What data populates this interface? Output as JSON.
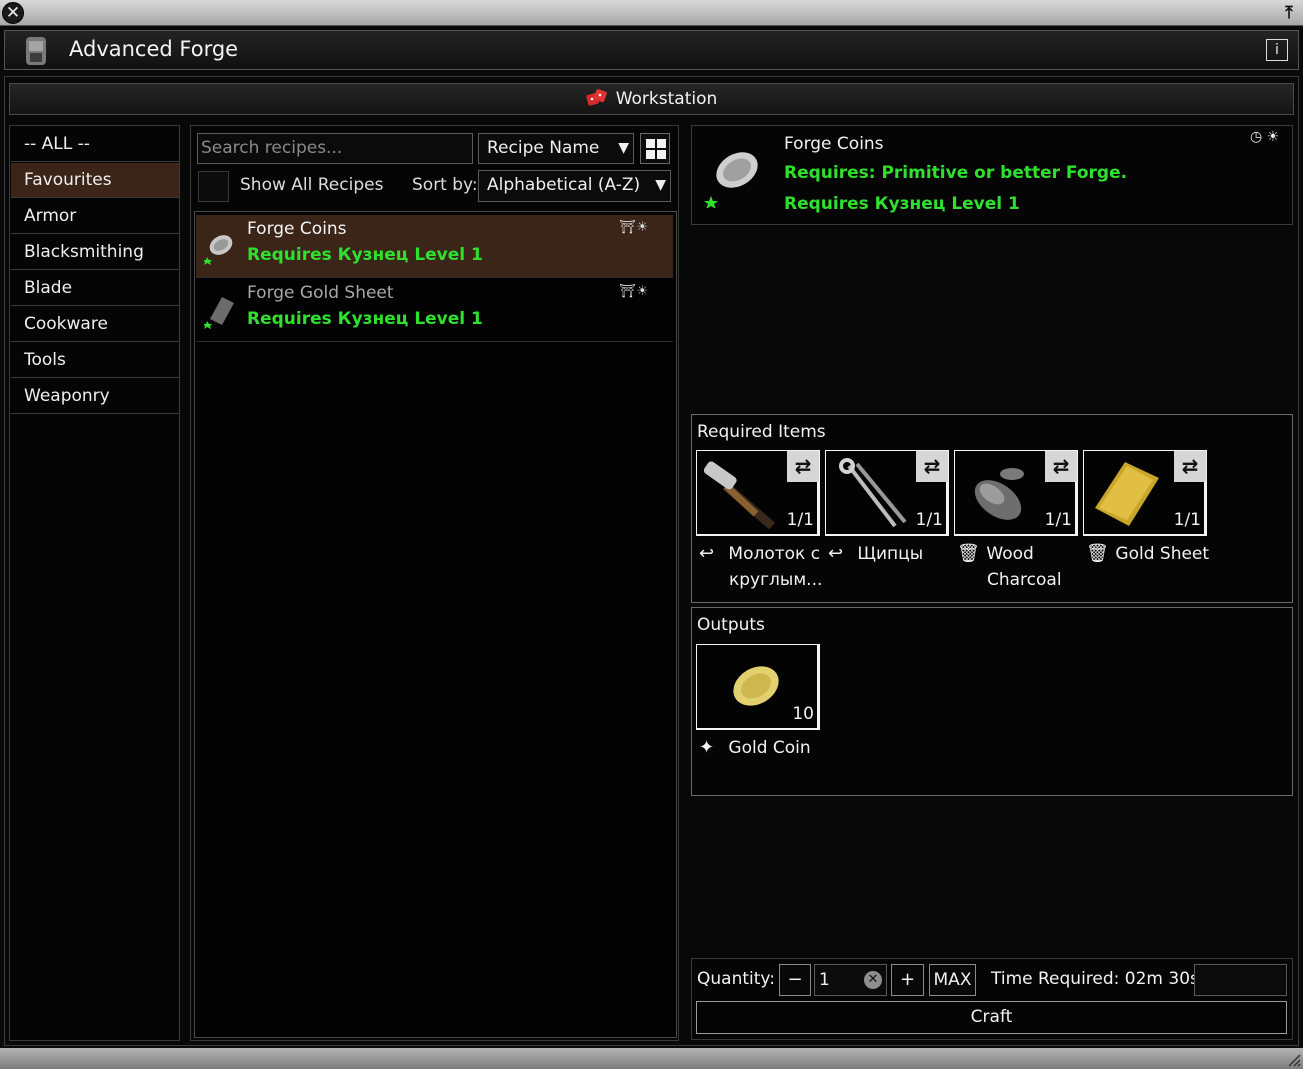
{
  "window": {
    "title": "Advanced Forge",
    "close_icon": "close-icon",
    "pin_icon": "pin-icon",
    "info_icon": "info-icon"
  },
  "workstation": {
    "label": "Workstation",
    "icon": "dice-icon"
  },
  "categories": [
    "-- ALL --",
    "Favourites",
    "Armor",
    "Blacksmithing",
    "Blade",
    "Cookware",
    "Tools",
    "Weaponry"
  ],
  "selected_category": "Favourites",
  "filters": {
    "search_placeholder": "Search recipes...",
    "recipe_name_dropdown": "Recipe Name",
    "show_all_label": "Show All Recipes",
    "sort_by_label": "Sort by:",
    "sort_value": "Alphabetical (A-Z)"
  },
  "recipes": [
    {
      "name": "Forge Coins",
      "requirement": "Requires Кузнец Level 1",
      "selected": true
    },
    {
      "name": "Forge Gold Sheet",
      "requirement": "Requires Кузнец Level 1",
      "selected": false
    }
  ],
  "detail": {
    "name": "Forge Coins",
    "req_station": "Requires: Primitive or better Forge.",
    "req_skill": "Requires Кузнец Level 1",
    "required_items_title": "Required Items",
    "required_items": [
      {
        "label_line1": "Молоток с",
        "label_line2": "круглым...",
        "count": "1/1",
        "label_icon": "return-icon"
      },
      {
        "label_line1": "Щипцы",
        "label_line2": "",
        "count": "1/1",
        "label_icon": "return-icon"
      },
      {
        "label_line1": "Wood",
        "label_line2": "Charcoal",
        "count": "1/1",
        "label_icon": "trash-icon"
      },
      {
        "label_line1": "Gold Sheet",
        "label_line2": "",
        "count": "1/1",
        "label_icon": "trash-icon"
      }
    ],
    "outputs_title": "Outputs",
    "outputs": [
      {
        "label": "Gold Coin",
        "count": "10",
        "label_icon": "sparkle-icon"
      }
    ]
  },
  "craft": {
    "quantity_label": "Quantity:",
    "quantity_value": "1",
    "minus": "−",
    "plus": "+",
    "max": "MAX",
    "time_label": "Time Required: 02m 30s",
    "craft_button": "Craft"
  },
  "colors": {
    "selected_row": "#3b2418",
    "requirement_green": "#2fe02f"
  }
}
